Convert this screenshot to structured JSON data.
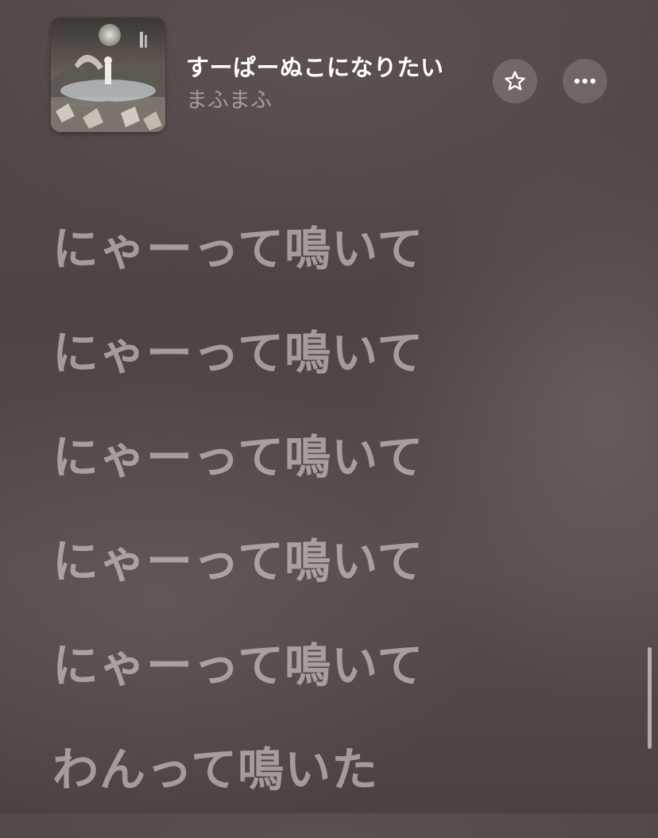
{
  "now_playing": {
    "title": "すーぱーぬこになりたい",
    "artist": "まふまふ",
    "artwork_icon": "album-artwork"
  },
  "controls": {
    "favorite_icon": "star-outline-icon",
    "more_icon": "ellipsis-icon"
  },
  "lyrics": {
    "lines": [
      "にゃーって鳴いて",
      "にゃーって鳴いて",
      "にゃーって鳴いて",
      "にゃーって鳴いて",
      "にゃーって鳴いて",
      "わんって鳴いた"
    ]
  },
  "colors": {
    "background": "#4f4645",
    "title": "#ffffff",
    "lyric_inactive": "#c4bcbb"
  }
}
